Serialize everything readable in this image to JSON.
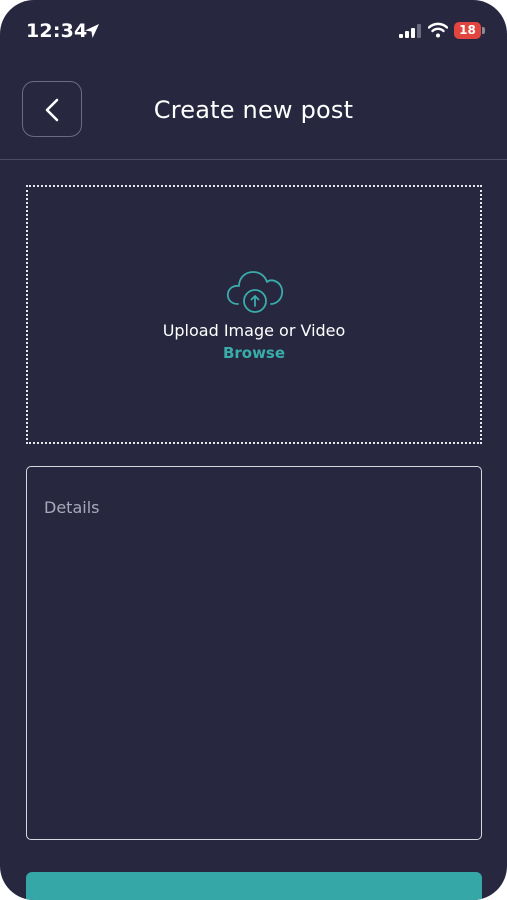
{
  "status_bar": {
    "time": "12:34",
    "battery_level": "18",
    "battery_color": "#e0463f",
    "icons": [
      "location-arrow-icon",
      "signal-icon",
      "wifi-icon",
      "battery-icon"
    ]
  },
  "header": {
    "back_icon": "chevron-left-icon",
    "title": "Create new post"
  },
  "upload": {
    "icon": "cloud-upload-icon",
    "label": "Upload Image or Video",
    "browse_label": "Browse"
  },
  "details": {
    "placeholder": "Details",
    "value": ""
  },
  "colors": {
    "background": "#272840",
    "accent": "#3aacaa",
    "submit_button": "#35a7a6"
  }
}
